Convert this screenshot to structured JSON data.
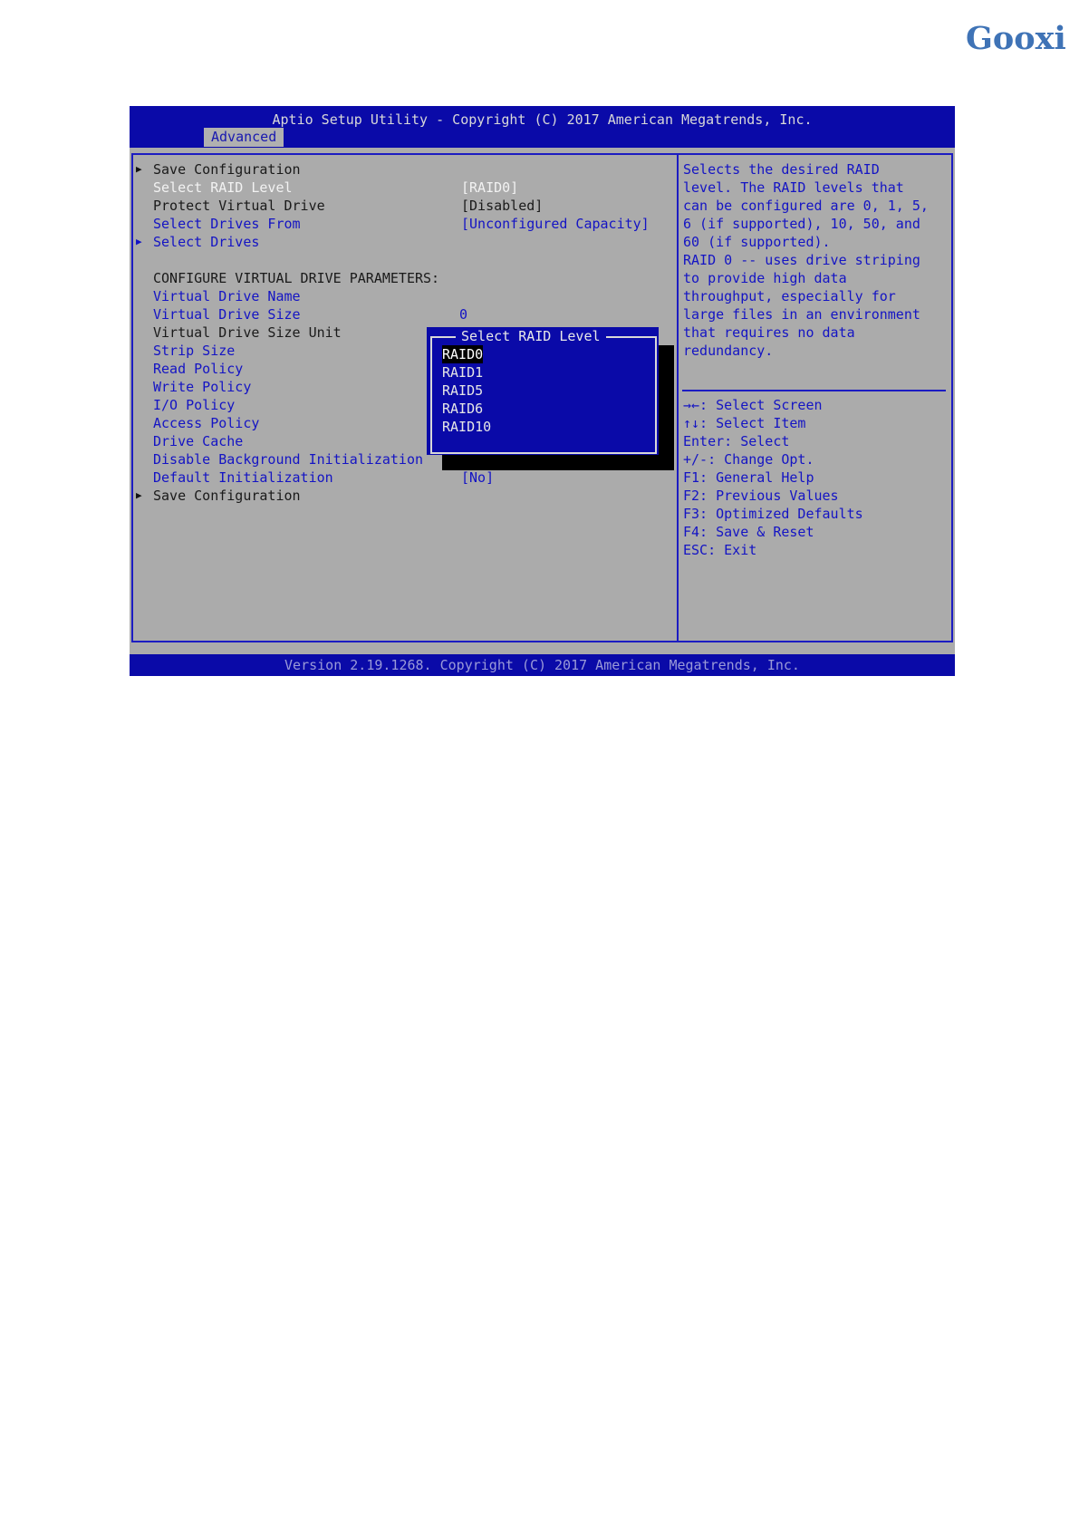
{
  "logo": "Gooxi",
  "header": {
    "title": "Aptio Setup Utility - Copyright (C) 2017 American Megatrends, Inc.",
    "tab": "Advanced"
  },
  "menu": [
    {
      "label": "Save Configuration",
      "value": "",
      "arrow": true
    },
    {
      "label": "Select RAID Level",
      "value": "[RAID0]",
      "arrow": false
    },
    {
      "label": "Protect Virtual Drive",
      "value": "[Disabled]",
      "arrow": false
    },
    {
      "label": "Select Drives From",
      "value": "[Unconfigured Capacity]",
      "arrow": false
    },
    {
      "label": "Select Drives",
      "value": "",
      "arrow": true
    },
    {
      "label": "CONFIGURE VIRTUAL DRIVE PARAMETERS:",
      "value": "",
      "arrow": false
    },
    {
      "label": "Virtual Drive Name",
      "value": "",
      "arrow": false
    },
    {
      "label": "Virtual Drive Size",
      "value": "0",
      "arrow": false
    },
    {
      "label": "Virtual Drive Size Unit",
      "value": "",
      "arrow": false
    },
    {
      "label": "Strip Size",
      "value": "",
      "arrow": false
    },
    {
      "label": "Read Policy",
      "value": "",
      "arrow": false
    },
    {
      "label": "Write Policy",
      "value": "",
      "arrow": false
    },
    {
      "label": "I/O Policy",
      "value": "",
      "arrow": false
    },
    {
      "label": "Access Policy",
      "value": "",
      "arrow": false
    },
    {
      "label": "Drive Cache",
      "value": "",
      "arrow": false
    },
    {
      "label": "Disable Background Initialization",
      "value": "",
      "arrow": false
    },
    {
      "label": "Default Initialization",
      "value": "[No]",
      "arrow": false
    },
    {
      "label": "Save Configuration",
      "value": "",
      "arrow": true
    }
  ],
  "popup": {
    "title": "Select RAID Level",
    "options": [
      "RAID0",
      "RAID1",
      "RAID5",
      "RAID6",
      "RAID10"
    ],
    "selected": "RAID0"
  },
  "help": [
    "Selects the desired RAID",
    "level. The RAID levels that",
    "can be configured are 0, 1, 5,",
    "6 (if supported), 10, 50, and",
    "60 (if supported).",
    "RAID 0 -- uses drive striping",
    "to provide high data",
    "throughput, especially for",
    "large files in an environment",
    "that requires no data",
    "redundancy."
  ],
  "keys": [
    "→←: Select Screen",
    "↑↓: Select Item",
    "Enter: Select",
    "+/-: Change Opt.",
    "F1: General Help",
    "F2: Previous Values",
    "F3: Optimized Defaults",
    "F4: Save & Reset",
    "ESC: Exit"
  ],
  "footer": "Version 2.19.1268. Copyright (C) 2017 American Megatrends, Inc.",
  "colors": {
    "bios_blue": "#0a0aa8",
    "panel_grey": "#ababab",
    "link_blue": "#1414c4",
    "logo_blue": "#3f73b6"
  }
}
